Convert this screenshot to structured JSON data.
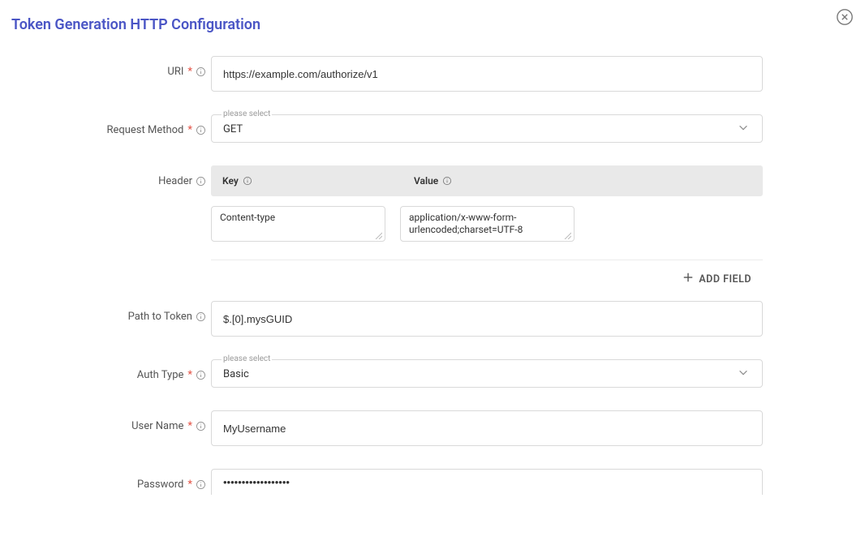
{
  "title": "Token Generation HTTP Configuration",
  "select_placeholder": "please select",
  "labels": {
    "uri": "URI",
    "request_method": "Request Method",
    "header": "Header",
    "key": "Key",
    "value": "Value",
    "add_field": "ADD FIELD",
    "path_to_token": "Path to Token",
    "auth_type": "Auth Type",
    "user_name": "User Name",
    "password": "Password"
  },
  "fields": {
    "uri": "https://example.com/authorize/v1",
    "request_method": "GET",
    "path_to_token": "$.[0].mysGUID",
    "auth_type": "Basic",
    "user_name": "MyUsername",
    "password": "••••••••••••••••••"
  },
  "header_rows": [
    {
      "key": "Content-type",
      "value": "application/x-www-form-urlencoded;charset=UTF-8"
    }
  ]
}
